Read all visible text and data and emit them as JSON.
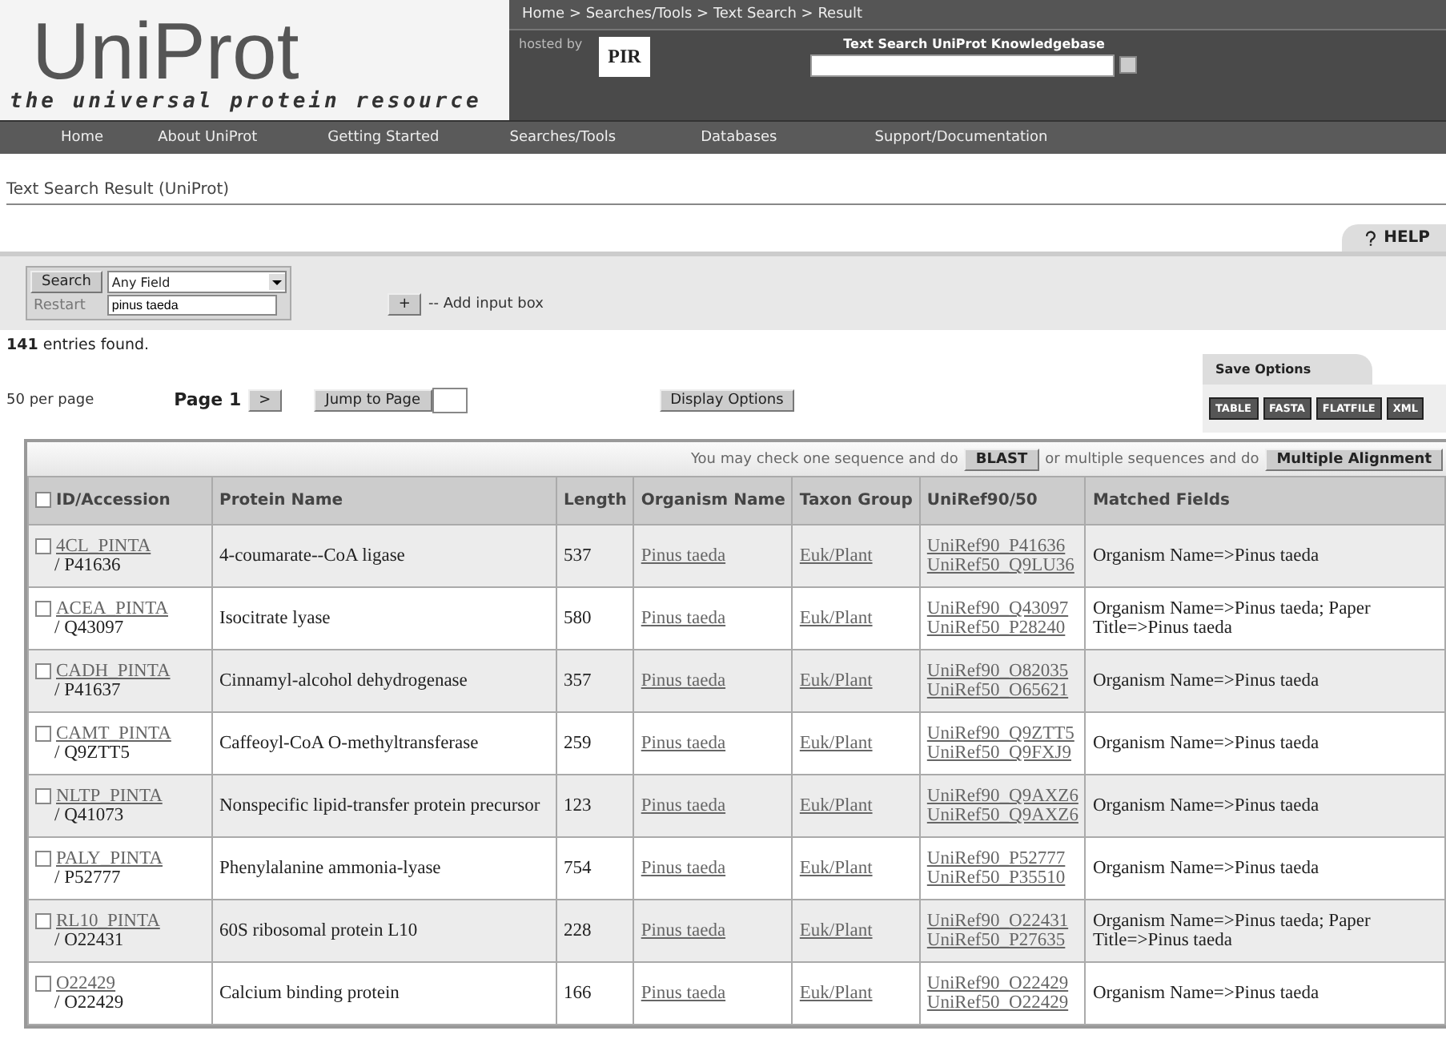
{
  "logo": {
    "title": "UniProt",
    "tagline": "the universal protein resource"
  },
  "breadcrumb": "Home > Searches/Tools > Text Search > Result",
  "hosted_by": "hosted by",
  "host_logo": "PIR",
  "quick_search": {
    "label": "Text Search UniProt Knowledgebase"
  },
  "nav": [
    "Home",
    "About UniProt",
    "Getting Started",
    "Searches/Tools",
    "Databases",
    "Support/Documentation"
  ],
  "page_title": "Text Search Result (UniProt)",
  "help": "HELP",
  "search_form": {
    "search_button": "Search",
    "restart_button": "Restart",
    "field_select": "Any Field",
    "query": "pinus taeda",
    "add_button": "+",
    "add_label": "-- Add input box"
  },
  "result_count": {
    "count": "141",
    "text": "entries found."
  },
  "paging": {
    "per_page": "50 per page",
    "page": "Page 1",
    "next": ">",
    "jump": "Jump to Page",
    "display_options": "Display Options"
  },
  "save_options": {
    "title": "Save Options",
    "formats": [
      "TABLE",
      "FASTA",
      "FLATFILE",
      "XML"
    ]
  },
  "action_bar": {
    "text1": "You may check one sequence and do",
    "blast": "BLAST",
    "text2": "or multiple sequences and do",
    "align": "Multiple Alignment"
  },
  "table": {
    "select_all_checked": false,
    "columns": [
      "ID/Accession",
      "Protein Name",
      "Length",
      "Organism Name",
      "Taxon Group",
      "UniRef90/50",
      "Matched Fields"
    ],
    "rows": [
      {
        "checked": false,
        "id": "4CL_PINTA",
        "accession": "/ P41636",
        "name": "4-coumarate--CoA ligase",
        "length": "537",
        "organism": "Pinus taeda",
        "taxon": "Euk/Plant",
        "uniref90": "UniRef90_P41636",
        "uniref50": "UniRef50_Q9LU36",
        "matched": "Organism Name=>Pinus taeda"
      },
      {
        "checked": false,
        "id": "ACEA_PINTA",
        "accession": "/ Q43097",
        "name": "Isocitrate lyase",
        "length": "580",
        "organism": "Pinus taeda",
        "taxon": "Euk/Plant",
        "uniref90": "UniRef90_Q43097",
        "uniref50": "UniRef50_P28240",
        "matched": "Organism Name=>Pinus taeda; Paper Title=>Pinus taeda"
      },
      {
        "checked": false,
        "id": "CADH_PINTA",
        "accession": "/ P41637",
        "name": "Cinnamyl-alcohol dehydrogenase",
        "length": "357",
        "organism": "Pinus taeda",
        "taxon": "Euk/Plant",
        "uniref90": "UniRef90_O82035",
        "uniref50": "UniRef50_O65621",
        "matched": "Organism Name=>Pinus taeda"
      },
      {
        "checked": false,
        "id": "CAMT_PINTA",
        "accession": "/ Q9ZTT5",
        "name": "Caffeoyl-CoA O-methyltransferase",
        "length": "259",
        "organism": "Pinus taeda",
        "taxon": "Euk/Plant",
        "uniref90": "UniRef90_Q9ZTT5",
        "uniref50": "UniRef50_Q9FXJ9",
        "matched": "Organism Name=>Pinus taeda"
      },
      {
        "checked": false,
        "id": "NLTP_PINTA",
        "accession": "/ Q41073",
        "name": "Nonspecific lipid-transfer protein precursor",
        "length": "123",
        "organism": "Pinus taeda",
        "taxon": "Euk/Plant",
        "uniref90": "UniRef90_Q9AXZ6",
        "uniref50": "UniRef50_Q9AXZ6",
        "matched": "Organism Name=>Pinus taeda"
      },
      {
        "checked": false,
        "id": "PALY_PINTA",
        "accession": "/ P52777",
        "name": "Phenylalanine ammonia-lyase",
        "length": "754",
        "organism": "Pinus taeda",
        "taxon": "Euk/Plant",
        "uniref90": "UniRef90_P52777",
        "uniref50": "UniRef50_P35510",
        "matched": "Organism Name=>Pinus taeda"
      },
      {
        "checked": false,
        "id": "RL10_PINTA",
        "accession": "/ O22431",
        "name": "60S ribosomal protein L10",
        "length": "228",
        "organism": "Pinus taeda",
        "taxon": "Euk/Plant",
        "uniref90": "UniRef90_O22431",
        "uniref50": "UniRef50_P27635",
        "matched": "Organism Name=>Pinus taeda; Paper Title=>Pinus taeda"
      },
      {
        "checked": false,
        "id": "O22429",
        "accession": "/ O22429",
        "name": "Calcium binding protein",
        "length": "166",
        "organism": "Pinus taeda",
        "taxon": "Euk/Plant",
        "uniref90": "UniRef90_O22429",
        "uniref50": "UniRef50_O22429",
        "matched": "Organism Name=>Pinus taeda"
      }
    ]
  }
}
